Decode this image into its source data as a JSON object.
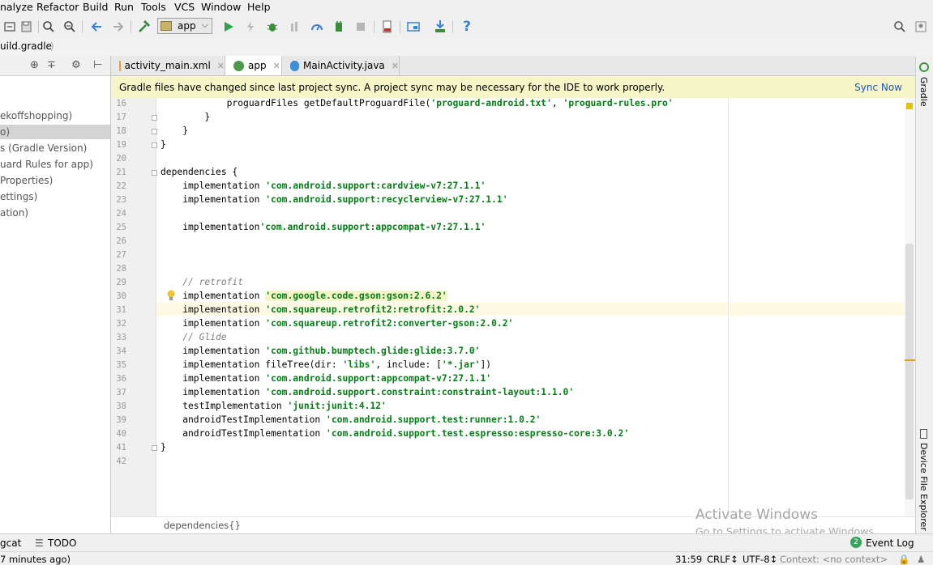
{
  "menu": [
    "nalyze",
    "Refactor",
    "Build",
    "Run",
    "Tools",
    "VCS",
    "Window",
    "Help"
  ],
  "run_config": {
    "label": "app"
  },
  "breadcrumb": "uild.gradle",
  "project_tree": [
    "ekoffshopping)",
    "o)",
    "s (Gradle Version)",
    "uard Rules for app)",
    "Properties)",
    "ettings)",
    "ation)"
  ],
  "tabs": [
    {
      "label": "activity_main.xml",
      "icon": "xml-file-icon",
      "color": "#e8a030"
    },
    {
      "label": "app",
      "icon": "gradle-icon",
      "color": "#4a9a4a"
    },
    {
      "label": "MainActivity.java",
      "icon": "java-class-icon",
      "color": "#3d8fd8"
    }
  ],
  "banner": {
    "message": "Gradle files have changed since last project sync. A project sync may be necessary for the IDE to work properly.",
    "action": "Sync Now"
  },
  "code": {
    "line_numbers": [
      "16",
      "17",
      "18",
      "19",
      "20",
      "21",
      "22",
      "23",
      "24",
      "25",
      "26",
      "27",
      "28",
      "29",
      "30",
      "31",
      "32",
      "33",
      "34",
      "35",
      "36",
      "37",
      "38",
      "39",
      "40",
      "41",
      "42"
    ],
    "l16a": "            proguardFiles getDefaultProguardFile(",
    "l16s1": "'proguard-android.txt'",
    "l16b": ", ",
    "l16s2": "'proguard-rules.pro'",
    "l17": "        }",
    "l18": "    }",
    "l19": "}",
    "l21": "dependencies {",
    "impl": "    implementation ",
    "impl_nospace": "    implementation",
    "l22s": "'com.android.support:cardview-v7:27.1.1'",
    "l23s": "'com.android.support:recyclerview-v7:27.1.1'",
    "l25s": "'com.android.support:appcompat-v7:27.1.1'",
    "l29": "    // retrofit",
    "l30s": "'com.google.code.gson:gson:2.6.2'",
    "l31s": "'com.squareup.retrofit2:retrofit:2.0.2'",
    "l32s": "'com.squareup.retrofit2:converter-gson:2.0.2'",
    "l33": "    // Glide",
    "l34s": "'com.github.bumptech.glide:glide:3.7.0'",
    "l35a": "    implementation fileTree(dir: ",
    "l35s1": "'libs'",
    "l35b": ", include: [",
    "l35s2": "'*.jar'",
    "l35c": "])",
    "l36s": "'com.android.support:appcompat-v7:27.1.1'",
    "l37s": "'com.android.support.constraint:constraint-layout:1.1.0'",
    "l38a": "    testImplementation ",
    "l38s": "'junit:junit:4.12'",
    "l39a": "    androidTestImplementation ",
    "l39s": "'com.android.support.test:runner:1.0.2'",
    "l40a": "    androidTestImplementation ",
    "l40s": "'com.android.support.test.espresso:espresso-core:3.0.2'",
    "l41": "}"
  },
  "editor_breadcrumb": "dependencies{}",
  "right_tools": [
    "Gradle",
    "Device File Explorer"
  ],
  "bottom_tools": {
    "logcat": "gcat",
    "todo": "TODO",
    "event_log": "Event Log",
    "event_count": "2"
  },
  "status": {
    "left": "7 minutes ago)",
    "position": "31:59",
    "line_sep": "CRLF↕",
    "encoding": "UTF-8↕",
    "context": "Context: <no context>"
  },
  "watermark": {
    "title": "Activate Windows",
    "subtitle": "Go to Settings to activate Windows."
  }
}
